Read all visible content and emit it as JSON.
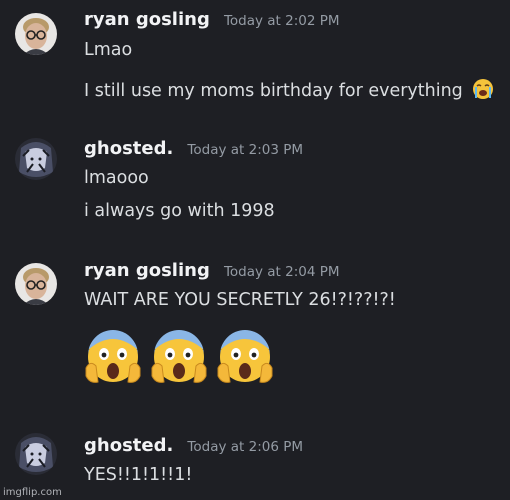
{
  "messages": [
    {
      "author": "ryan gosling",
      "timestamp": "Today at 2:02 PM",
      "avatar_icon": "ryan-avatar",
      "lines": [
        "Lmao",
        "I still use my moms birthday for everything"
      ],
      "inline_emoji": "loudly-crying-face-icon"
    },
    {
      "author": "ghosted.",
      "timestamp": "Today at 2:03 PM",
      "avatar_icon": "ghosted-avatar",
      "lines": [
        "lmaooo",
        "i always go with 1998"
      ]
    },
    {
      "author": "ryan gosling",
      "timestamp": "Today at 2:04 PM",
      "avatar_icon": "ryan-avatar",
      "lines": [
        "WAIT ARE YOU SECRETLY 26!?!??!?!"
      ],
      "big_emojis": [
        "face-screaming-in-fear-icon",
        "face-screaming-in-fear-icon",
        "face-screaming-in-fear-icon"
      ]
    },
    {
      "author": "ghosted.",
      "timestamp": "Today at 2:06 PM",
      "avatar_icon": "ghosted-avatar",
      "lines": [
        "YES!!1!1!!1!"
      ]
    }
  ],
  "watermark": "imgflip.com",
  "colors": {
    "background": "#1e1f24",
    "username": "#f2f3f5",
    "timestamp": "#949ba4",
    "message_text": "#dbdee1"
  }
}
